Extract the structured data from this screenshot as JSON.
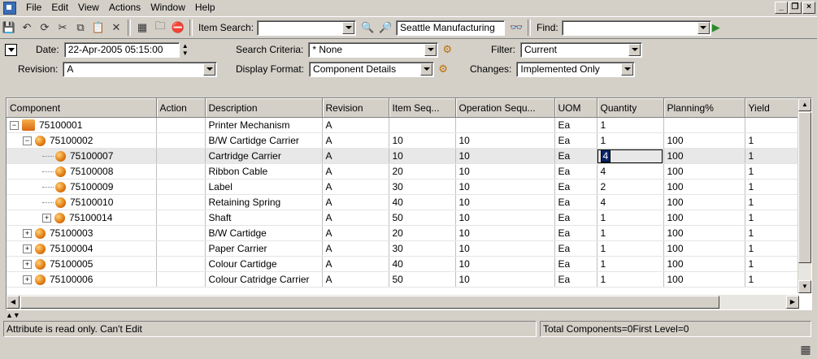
{
  "menu": [
    "File",
    "Edit",
    "View",
    "Actions",
    "Window",
    "Help"
  ],
  "toolbar": {
    "item_search_label": "Item Search:",
    "item_search_value": "",
    "organization": "Seattle Manufacturing",
    "find_label": "Find:",
    "find_value": ""
  },
  "criteria": {
    "date_label": "Date:",
    "date_value": "22-Apr-2005 05:15:00",
    "search_criteria_label": "Search Criteria:",
    "search_criteria_value": "* None",
    "filter_label": "Filter:",
    "filter_value": "Current",
    "revision_label": "Revision:",
    "revision_value": "A",
    "display_format_label": "Display Format:",
    "display_format_value": "Component Details",
    "changes_label": "Changes:",
    "changes_value": "Implemented Only"
  },
  "grid": {
    "columns": [
      "Component",
      "Action",
      "Description",
      "Revision",
      "Item Seq...",
      "Operation Sequ...",
      "UOM",
      "Quantity",
      "Planning%",
      "Yield"
    ],
    "rows": [
      {
        "component": "75100001",
        "action": "",
        "description": "Printer Mechanism",
        "revision": "A",
        "item_seq": "",
        "op_seq": "",
        "uom": "Ea",
        "quantity": "1",
        "planning": "",
        "yield": ""
      },
      {
        "component": "75100002",
        "action": "",
        "description": "B/W Cartidge Carrier",
        "revision": "A",
        "item_seq": "10",
        "op_seq": "10",
        "uom": "Ea",
        "quantity": "1",
        "planning": "100",
        "yield": "1"
      },
      {
        "component": "75100007",
        "action": "",
        "description": "Cartridge Carrier",
        "revision": "A",
        "item_seq": "10",
        "op_seq": "10",
        "uom": "Ea",
        "quantity": "4",
        "planning": "100",
        "yield": "1"
      },
      {
        "component": "75100008",
        "action": "",
        "description": "Ribbon Cable",
        "revision": "A",
        "item_seq": "20",
        "op_seq": "10",
        "uom": "Ea",
        "quantity": "4",
        "planning": "100",
        "yield": "1"
      },
      {
        "component": "75100009",
        "action": "",
        "description": "Label",
        "revision": "A",
        "item_seq": "30",
        "op_seq": "10",
        "uom": "Ea",
        "quantity": "2",
        "planning": "100",
        "yield": "1"
      },
      {
        "component": "75100010",
        "action": "",
        "description": "Retaining Spring",
        "revision": "A",
        "item_seq": "40",
        "op_seq": "10",
        "uom": "Ea",
        "quantity": "4",
        "planning": "100",
        "yield": "1"
      },
      {
        "component": "75100014",
        "action": "",
        "description": "Shaft",
        "revision": "A",
        "item_seq": "50",
        "op_seq": "10",
        "uom": "Ea",
        "quantity": "1",
        "planning": "100",
        "yield": "1"
      },
      {
        "component": "75100003",
        "action": "",
        "description": "B/W Cartidge",
        "revision": "A",
        "item_seq": "20",
        "op_seq": "10",
        "uom": "Ea",
        "quantity": "1",
        "planning": "100",
        "yield": "1"
      },
      {
        "component": "75100004",
        "action": "",
        "description": "Paper Carrier",
        "revision": "A",
        "item_seq": "30",
        "op_seq": "10",
        "uom": "Ea",
        "quantity": "1",
        "planning": "100",
        "yield": "1"
      },
      {
        "component": "75100005",
        "action": "",
        "description": "Colour Cartidge",
        "revision": "A",
        "item_seq": "40",
        "op_seq": "10",
        "uom": "Ea",
        "quantity": "1",
        "planning": "100",
        "yield": "1"
      },
      {
        "component": "75100006",
        "action": "",
        "description": "Colour Catridge Carrier",
        "revision": "A",
        "item_seq": "50",
        "op_seq": "10",
        "uom": "Ea",
        "quantity": "1",
        "planning": "100",
        "yield": "1"
      }
    ]
  },
  "status": {
    "message": "Attribute is read only. Can't Edit",
    "totals": "Total Components=0First Level=0"
  }
}
